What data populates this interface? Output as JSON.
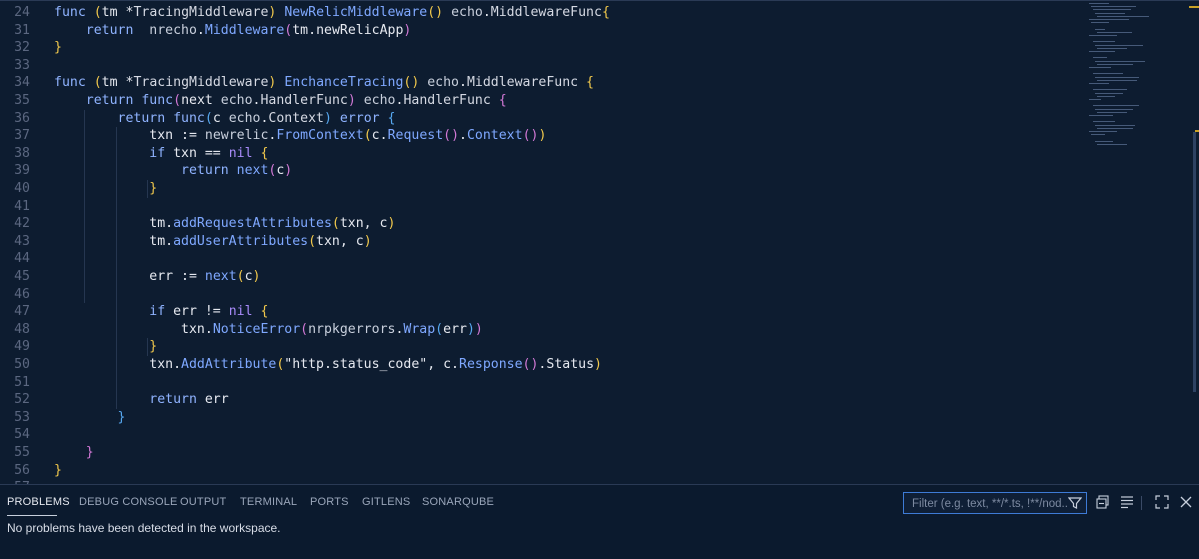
{
  "editor": {
    "lines": [
      {
        "n": "24",
        "toks": [
          [
            "func ",
            "kw"
          ],
          [
            "(",
            "b1"
          ],
          [
            "tm ",
            "id"
          ],
          [
            "*",
            "op"
          ],
          [
            "TracingMiddleware",
            "ty"
          ],
          [
            ") ",
            "b1"
          ],
          [
            "NewRelicMiddleware",
            "fn"
          ],
          [
            "() ",
            "b1"
          ],
          [
            "echo",
            "pk"
          ],
          [
            ".",
            "op"
          ],
          [
            "MiddlewareFunc",
            "ty"
          ],
          [
            "{",
            "b1"
          ]
        ]
      },
      {
        "n": "31",
        "toks": [
          [
            "    return  ",
            "kw"
          ],
          [
            "nrecho",
            "pk"
          ],
          [
            ".",
            "op"
          ],
          [
            "Middleware",
            "fn"
          ],
          [
            "(",
            "b2"
          ],
          [
            "tm",
            "id"
          ],
          [
            ".",
            "op"
          ],
          [
            "newRelicApp",
            "id"
          ],
          [
            ")",
            "b2"
          ]
        ]
      },
      {
        "n": "32",
        "toks": [
          [
            "}",
            "b1"
          ]
        ]
      },
      {
        "n": "33",
        "toks": []
      },
      {
        "n": "34",
        "toks": [
          [
            "func ",
            "kw"
          ],
          [
            "(",
            "b1"
          ],
          [
            "tm ",
            "id"
          ],
          [
            "*",
            "op"
          ],
          [
            "TracingMiddleware",
            "ty"
          ],
          [
            ") ",
            "b1"
          ],
          [
            "EnchanceTracing",
            "fn"
          ],
          [
            "() ",
            "b1"
          ],
          [
            "echo",
            "pk"
          ],
          [
            ".",
            "op"
          ],
          [
            "MiddlewareFunc ",
            "ty"
          ],
          [
            "{",
            "b1"
          ]
        ]
      },
      {
        "n": "35",
        "toks": [
          [
            "    return ",
            "kw"
          ],
          [
            "func",
            "kw"
          ],
          [
            "(",
            "b2"
          ],
          [
            "next ",
            "id"
          ],
          [
            "echo",
            "pk"
          ],
          [
            ".",
            "op"
          ],
          [
            "HandlerFunc",
            "ty"
          ],
          [
            ") ",
            "b2"
          ],
          [
            "echo",
            "pk"
          ],
          [
            ".",
            "op"
          ],
          [
            "HandlerFunc ",
            "ty"
          ],
          [
            "{",
            "b2"
          ]
        ]
      },
      {
        "n": "36",
        "toks": [
          [
            "        return ",
            "kw"
          ],
          [
            "func",
            "kw"
          ],
          [
            "(",
            "b3"
          ],
          [
            "c ",
            "id"
          ],
          [
            "echo",
            "pk"
          ],
          [
            ".",
            "op"
          ],
          [
            "Context",
            "ty"
          ],
          [
            ") ",
            "b3"
          ],
          [
            "error ",
            "kw"
          ],
          [
            "{",
            "b3"
          ]
        ]
      },
      {
        "n": "37",
        "toks": [
          [
            "            txn ",
            "id"
          ],
          [
            ":= ",
            "op"
          ],
          [
            "newrelic",
            "pk"
          ],
          [
            ".",
            "op"
          ],
          [
            "FromContext",
            "fn"
          ],
          [
            "(",
            "b1"
          ],
          [
            "c",
            "id"
          ],
          [
            ".",
            "op"
          ],
          [
            "Request",
            "fn"
          ],
          [
            "()",
            "b2"
          ],
          [
            ".",
            "op"
          ],
          [
            "Context",
            "fn"
          ],
          [
            "()",
            "b2"
          ],
          [
            ")",
            "b1"
          ]
        ]
      },
      {
        "n": "38",
        "toks": [
          [
            "            if ",
            "kw"
          ],
          [
            "txn ",
            "id"
          ],
          [
            "== ",
            "op"
          ],
          [
            "nil ",
            "nil"
          ],
          [
            "{",
            "b1"
          ]
        ]
      },
      {
        "n": "39",
        "toks": [
          [
            "                return ",
            "kw"
          ],
          [
            "next",
            "fn"
          ],
          [
            "(",
            "b2"
          ],
          [
            "c",
            "id"
          ],
          [
            ")",
            "b2"
          ]
        ]
      },
      {
        "n": "40",
        "toks": [
          [
            "            }",
            "b1"
          ]
        ]
      },
      {
        "n": "41",
        "toks": []
      },
      {
        "n": "42",
        "toks": [
          [
            "            tm",
            "id"
          ],
          [
            ".",
            "op"
          ],
          [
            "addRequestAttributes",
            "fn"
          ],
          [
            "(",
            "b1"
          ],
          [
            "txn, c",
            "id"
          ],
          [
            ")",
            "b1"
          ]
        ]
      },
      {
        "n": "43",
        "toks": [
          [
            "            tm",
            "id"
          ],
          [
            ".",
            "op"
          ],
          [
            "addUserAttributes",
            "fn"
          ],
          [
            "(",
            "b1"
          ],
          [
            "txn, c",
            "id"
          ],
          [
            ")",
            "b1"
          ]
        ]
      },
      {
        "n": "44",
        "toks": []
      },
      {
        "n": "45",
        "toks": [
          [
            "            err ",
            "id"
          ],
          [
            ":= ",
            "op"
          ],
          [
            "next",
            "fn"
          ],
          [
            "(",
            "b1"
          ],
          [
            "c",
            "id"
          ],
          [
            ")",
            "b1"
          ]
        ]
      },
      {
        "n": "46",
        "toks": []
      },
      {
        "n": "47",
        "toks": [
          [
            "            if ",
            "kw"
          ],
          [
            "err ",
            "id"
          ],
          [
            "!= ",
            "op"
          ],
          [
            "nil ",
            "nil"
          ],
          [
            "{",
            "b1"
          ]
        ]
      },
      {
        "n": "48",
        "toks": [
          [
            "                txn",
            "id"
          ],
          [
            ".",
            "op"
          ],
          [
            "NoticeError",
            "fn"
          ],
          [
            "(",
            "b2"
          ],
          [
            "nrpkgerrors",
            "pk"
          ],
          [
            ".",
            "op"
          ],
          [
            "Wrap",
            "fn"
          ],
          [
            "(",
            "b3"
          ],
          [
            "err",
            "id"
          ],
          [
            ")",
            "b3"
          ],
          [
            ")",
            "b2"
          ]
        ]
      },
      {
        "n": "49",
        "toks": [
          [
            "            }",
            "b1"
          ]
        ]
      },
      {
        "n": "50",
        "toks": [
          [
            "            txn",
            "id"
          ],
          [
            ".",
            "op"
          ],
          [
            "AddAttribute",
            "fn"
          ],
          [
            "(",
            "b1"
          ],
          [
            "\"http.status_code\"",
            "str"
          ],
          [
            ", ",
            "op"
          ],
          [
            "c",
            "id"
          ],
          [
            ".",
            "op"
          ],
          [
            "Response",
            "fn"
          ],
          [
            "()",
            "b2"
          ],
          [
            ".",
            "op"
          ],
          [
            "Status",
            "id"
          ],
          [
            ")",
            "b1"
          ]
        ]
      },
      {
        "n": "51",
        "toks": []
      },
      {
        "n": "52",
        "toks": [
          [
            "            return ",
            "kw"
          ],
          [
            "err",
            "id"
          ]
        ]
      },
      {
        "n": "53",
        "toks": [
          [
            "        }",
            "b3"
          ]
        ]
      },
      {
        "n": "54",
        "toks": []
      },
      {
        "n": "55",
        "toks": [
          [
            "    }",
            "b2"
          ]
        ]
      },
      {
        "n": "56",
        "toks": [
          [
            "}",
            "b1"
          ]
        ]
      },
      {
        "n": "57",
        "toks": []
      }
    ]
  },
  "panel": {
    "tabs": [
      {
        "label": "PROBLEMS",
        "active": true
      },
      {
        "label": "DEBUG CONSOLE",
        "active": false
      },
      {
        "label": "OUTPUT",
        "active": false
      },
      {
        "label": "TERMINAL",
        "active": false
      },
      {
        "label": "PORTS",
        "active": false
      },
      {
        "label": "GITLENS",
        "active": false
      },
      {
        "label": "SONARQUBE",
        "active": false
      }
    ],
    "filter_placeholder": "Filter (e.g. text, **/*.ts, !**/nod...",
    "message": "No problems have been detected in the workspace.",
    "icons": [
      "filter-icon",
      "collapse-all-icon",
      "word-wrap-icon",
      "maximize-panel-icon",
      "close-icon"
    ]
  }
}
